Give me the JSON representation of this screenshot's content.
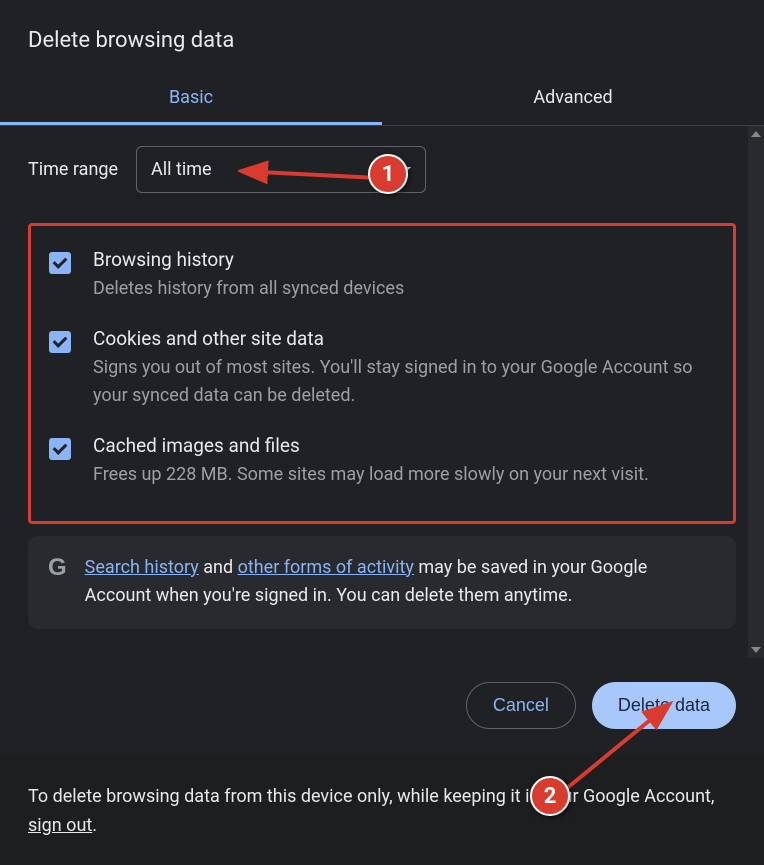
{
  "title": "Delete browsing data",
  "tabs": {
    "basic": "Basic",
    "advanced": "Advanced"
  },
  "time_range": {
    "label": "Time range",
    "value": "All time"
  },
  "options": {
    "browsing": {
      "title": "Browsing history",
      "desc": "Deletes history from all synced devices"
    },
    "cookies": {
      "title": "Cookies and other site data",
      "desc": "Signs you out of most sites. You'll stay signed in to your Google Account so your synced data can be deleted."
    },
    "cache": {
      "title": "Cached images and files",
      "desc": "Frees up 228 MB. Some sites may load more slowly on your next visit."
    }
  },
  "info": {
    "link1": "Search history",
    "mid1": " and ",
    "link2": "other forms of activity",
    "rest": " may be saved in your Google Account when you're signed in. You can delete them anytime."
  },
  "buttons": {
    "cancel": "Cancel",
    "delete": "Delete data"
  },
  "footer_note": {
    "text_before": "To delete browsing data from this device only, while keeping it in your Google Account, ",
    "link": "sign out",
    "text_after": "."
  },
  "annotations": {
    "one": "1",
    "two": "2"
  },
  "colors": {
    "accent": "#8ab4f8",
    "annotation_red": "#d93b2f",
    "bg": "#202124"
  }
}
